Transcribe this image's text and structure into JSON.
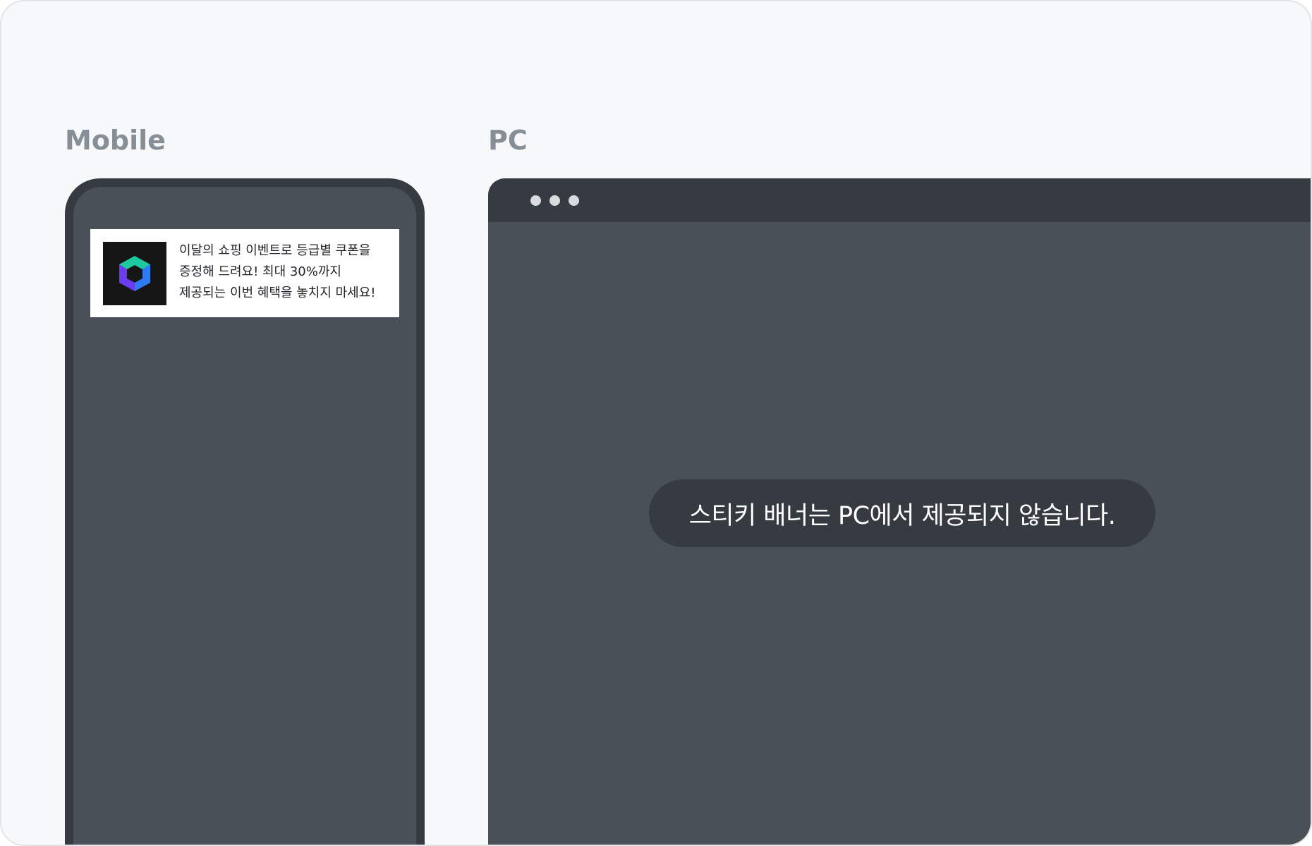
{
  "sections": {
    "mobile_label": "Mobile",
    "pc_label": "PC"
  },
  "mobile": {
    "banner": {
      "logo_icon": "cube-logo-icon",
      "text": "이달의 쇼핑 이벤트로 등급별 쿠폰을 증정해 드려요! 최대 30%까지 제공되는 이번 혜택을 놓치지 마세요!"
    }
  },
  "pc": {
    "window_controls": [
      "dot",
      "dot",
      "dot"
    ],
    "notice": "스티키 배너는 PC에서 제공되지 않습니다."
  },
  "colors": {
    "background": "#f7f8f9",
    "label": "#868e96",
    "device_frame": "#363b42",
    "screen": "#4a5058",
    "logo_bg": "#161616",
    "logo_top": "#1ec9a0",
    "logo_left": "#6a3df0",
    "logo_right": "#2f7bf5"
  }
}
